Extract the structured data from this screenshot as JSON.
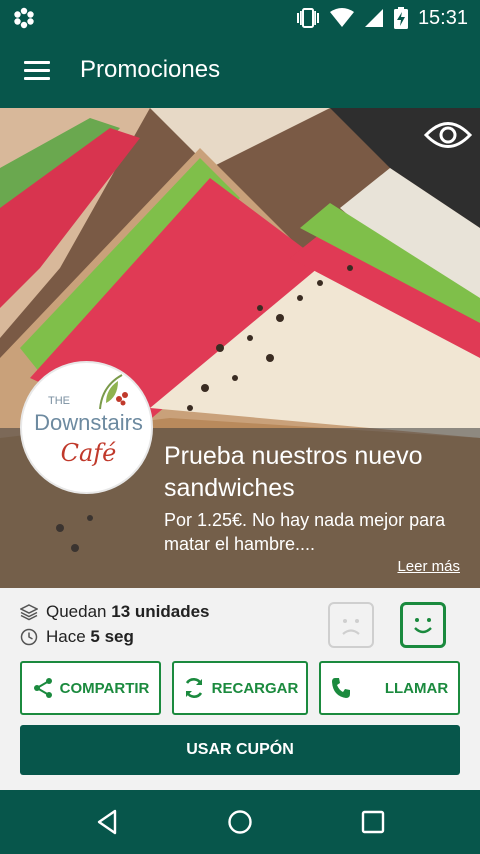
{
  "status_bar": {
    "time": "15:31",
    "icons": [
      "app-notification-icon",
      "vibrate-icon",
      "wifi-icon",
      "signal-icon",
      "battery-charging-icon"
    ]
  },
  "app_bar": {
    "title": "Promociones",
    "menu_icon": "hamburger-menu-icon"
  },
  "promotion": {
    "business_logo": {
      "the": "THE",
      "name": "Downstairs",
      "cafe": "Café"
    },
    "title": "Prueba nuestros nuevo sandwiches",
    "description": "Por 1.25€. No hay nada mejor para matar el hambre....",
    "more_link": "Leer más",
    "view_icon": "eye-icon"
  },
  "info": {
    "remaining_prefix": "Quedan",
    "remaining_value": "13 unidades",
    "time_prefix": "Hace",
    "time_value": "5 seg"
  },
  "actions": {
    "share": "COMPARTIR",
    "reload": "RECARGAR",
    "call": "LLAMAR",
    "use_coupon": "USAR CUPÓN"
  },
  "colors": {
    "primary": "#07564b",
    "accent": "#1b8a3e"
  }
}
